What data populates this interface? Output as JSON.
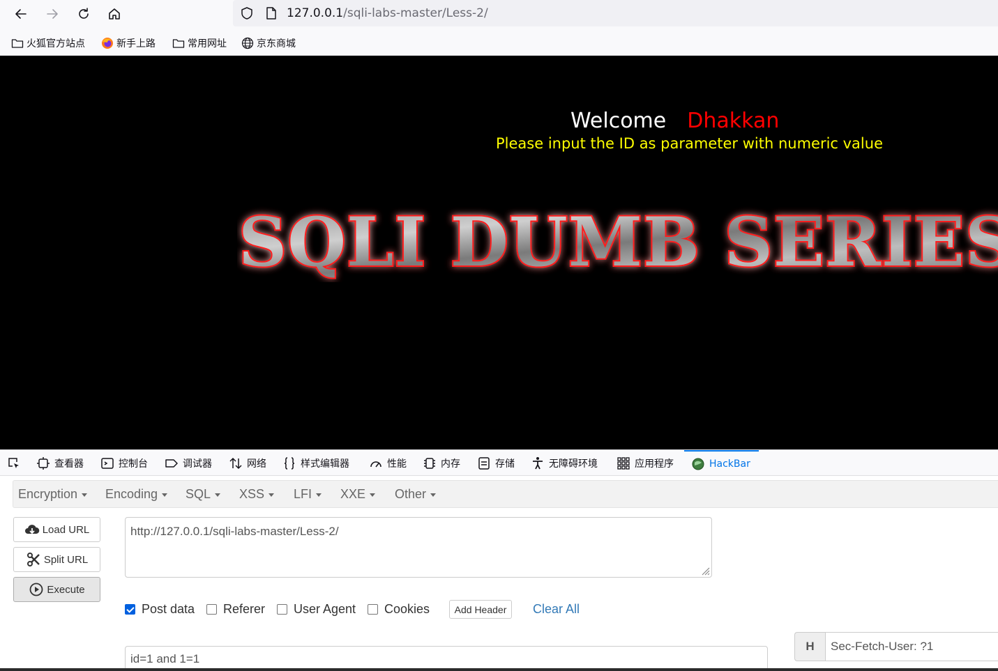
{
  "browser": {
    "url_host": "127.0.0.1",
    "url_path": "/sqli-labs-master/Less-2/"
  },
  "bookmarks": [
    {
      "label": "火狐官方站点",
      "icon": "folder-icon"
    },
    {
      "label": "新手上路",
      "icon": "firefox-icon"
    },
    {
      "label": "常用网址",
      "icon": "folder-icon"
    },
    {
      "label": "京东商城",
      "icon": "globe-icon"
    }
  ],
  "page": {
    "welcome": "Welcome",
    "name": "Dhakkan",
    "hint": "Please input the ID as parameter with numeric value",
    "banner": "SQLI DUMB SERIES",
    "colors": {
      "name": "#ff0000",
      "hint": "#ffff00",
      "background": "#000000"
    }
  },
  "devtools": {
    "tabs": [
      "查看器",
      "控制台",
      "调试器",
      "网络",
      "样式编辑器",
      "性能",
      "内存",
      "存储",
      "无障碍环境",
      "应用程序",
      "HackBar"
    ],
    "active": "HackBar"
  },
  "hackbar": {
    "menu": [
      "Encryption",
      "Encoding",
      "SQL",
      "XSS",
      "LFI",
      "XXE",
      "Other"
    ],
    "buttons": {
      "load": "Load URL",
      "split": "Split URL",
      "execute": "Execute"
    },
    "url": "http://127.0.0.1/sqli-labs-master/Less-2/",
    "options": {
      "post_data": "Post data",
      "referer": "Referer",
      "user_agent": "User Agent",
      "cookies": "Cookies"
    },
    "post_checked": true,
    "add_header": "Add Header",
    "clear_all": "Clear All",
    "post_body": "id=1 and 1=1",
    "header_label": "H",
    "header_value": "Sec-Fetch-User: ?1"
  }
}
